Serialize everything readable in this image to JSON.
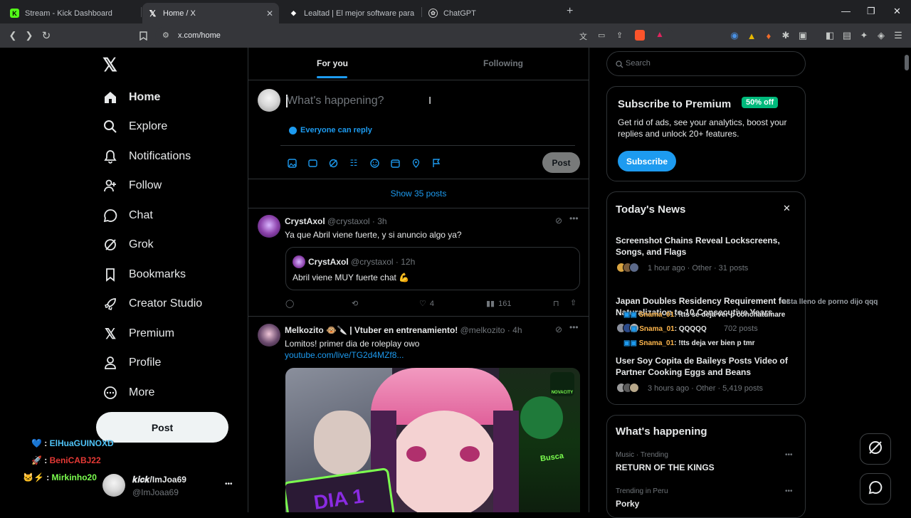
{
  "browser": {
    "tabs": [
      {
        "label": "Stream - Kick Dashboard",
        "icon": "kick-icon",
        "active": false
      },
      {
        "label": "Home / X",
        "icon": "x-icon",
        "active": true
      },
      {
        "label": "Lealtad | El mejor software para poter",
        "icon": "loyalty-icon",
        "active": false
      },
      {
        "label": "ChatGPT",
        "icon": "chatgpt-icon",
        "active": false
      }
    ],
    "new_tab": "+",
    "url": "x.com/home",
    "controls": {
      "minimize": "—",
      "restore": "❐",
      "close": "✕"
    }
  },
  "sidebar": {
    "logo": "X",
    "items": [
      {
        "label": "Home",
        "icon": "home-icon"
      },
      {
        "label": "Explore",
        "icon": "search-icon"
      },
      {
        "label": "Notifications",
        "icon": "bell-icon"
      },
      {
        "label": "Follow",
        "icon": "follow-icon"
      },
      {
        "label": "Chat",
        "icon": "chat-icon"
      },
      {
        "label": "Grok",
        "icon": "grok-icon"
      },
      {
        "label": "Bookmarks",
        "icon": "bookmark-icon"
      },
      {
        "label": "Creator Studio",
        "icon": "rocket-icon"
      },
      {
        "label": "Premium",
        "icon": "x-premium-icon"
      },
      {
        "label": "Profile",
        "icon": "person-icon"
      },
      {
        "label": "More",
        "icon": "more-circle-icon"
      }
    ],
    "post_button": "Post",
    "account": {
      "name": "𝒌𝒊𝒄𝒌/ImJoa69",
      "handle": "@ImJoaa69",
      "menu": "•••"
    }
  },
  "stream_overlay_left": [
    {
      "prefix": "💙 : ",
      "name": "ElHuaGUINOXD",
      "color": "#4fc3f7"
    },
    {
      "prefix": "🚀 : ",
      "name": "BeniCABJ22",
      "color": "#e53935"
    },
    {
      "prefix": "🐱⚡ : ",
      "name": "Mirkinho20",
      "color": "#7cff4f"
    }
  ],
  "feed": {
    "tabs": [
      "For you",
      "Following"
    ],
    "composer": {
      "placeholder": "What's happening?",
      "reply_setting": "Everyone can reply",
      "post_button": "Post"
    },
    "show_posts": "Show 35 posts",
    "posts": [
      {
        "name": "CrystAxol",
        "handle": "@crystaxol · 3h",
        "text": "Ya que Abril viene fuerte, y si anuncio algo ya?",
        "quote": {
          "name": "CrystAxol",
          "handle": "@crystaxol · 12h",
          "text": "Abril viene MUY fuerte chat 💪"
        },
        "likes": "4",
        "views": "161"
      },
      {
        "name": "Melkozito 🐵🔪 | Vtuber en entrenamiento!",
        "handle": "@melkozito · 4h",
        "text": "Lomitos! primer dia de roleplay owo",
        "link": "youtube.com/live/TG2d4MZf8...",
        "image_texts": {
          "badge": "NOVACITY",
          "sign": "Busca",
          "banner": "DIA 1"
        }
      }
    ]
  },
  "right": {
    "search_placeholder": "Search",
    "premium": {
      "title": "Subscribe to Premium",
      "badge": "50% off",
      "text": "Get rid of ads, see your analytics, boost your replies and unlock 20+ features.",
      "button": "Subscribe"
    },
    "news": {
      "title": "Today's News",
      "close": "✕",
      "items": [
        {
          "headline": "Screenshot Chains Reveal Lockscreens, Songs, and Flags",
          "meta": "1 hour ago · Other · 31 posts"
        },
        {
          "headline": "Japan Doubles Residency Requirement for Naturalization to 10 Consecutive Years",
          "meta": "702 posts"
        },
        {
          "headline": "User Soy Copita de Baileys Posts Video of Partner Cooking Eggs and Beans",
          "meta": "3 hours ago · Other · 5,419 posts"
        }
      ]
    },
    "happening": {
      "title": "What's happening",
      "items": [
        {
          "context": "Music · Trending",
          "topic": "RETURN OF THE KINGS"
        },
        {
          "context": "Trending in Peru",
          "topic": "Porky"
        }
      ]
    }
  },
  "stream_chat_overlay": [
    {
      "user": "",
      "msg": "esta lleno de porno dijo qqq"
    },
    {
      "user": "Snama_01",
      "msg": ": !tts se deja ver p conchatumare"
    },
    {
      "user": "Snama_01",
      "msg": ": QQQQQ"
    },
    {
      "user": "Snama_01",
      "msg": ": !tts deja ver bien p tmr"
    }
  ],
  "colors": {
    "accent": "#1d9bf0",
    "background": "#000000",
    "border": "#2f3336",
    "muted": "#71767b",
    "premium_badge": "#00ba7c"
  }
}
